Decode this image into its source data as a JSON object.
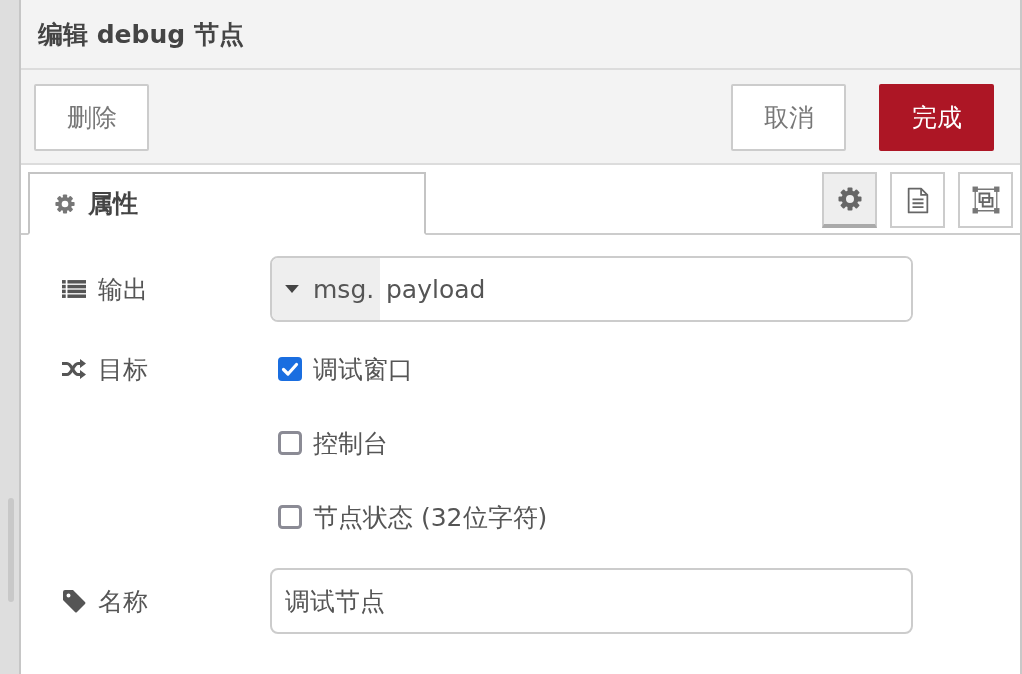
{
  "dialog": {
    "title": "编辑 debug 节点"
  },
  "left_buttons": [
    {
      "label": "删除",
      "kind": "plain"
    }
  ],
  "right_buttons": [
    {
      "label": "取消",
      "kind": "plain"
    },
    {
      "label": "完成",
      "kind": "primary"
    }
  ],
  "tabs": [
    {
      "label": "属性",
      "selected": true
    }
  ],
  "side_buttons": [
    {
      "selected": true
    },
    {
      "selected": false
    },
    {
      "selected": false
    }
  ],
  "form": [
    {
      "kind": "typed_input",
      "label": "输出",
      "type": "msg.",
      "value": "payload"
    },
    {
      "kind": "checkboxes",
      "label": "目标",
      "options": [
        {
          "label": "调试窗口",
          "checked": true
        },
        {
          "label": "控制台",
          "checked": false
        },
        {
          "label": "节点状态 (32位字符)",
          "checked": false
        }
      ]
    },
    {
      "kind": "text_input",
      "label": "名称",
      "value": "调试节点"
    }
  ]
}
